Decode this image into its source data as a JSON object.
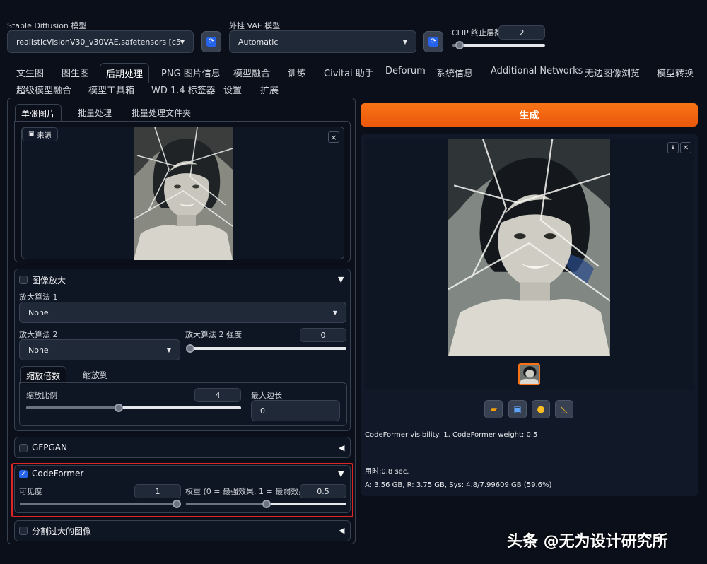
{
  "header": {
    "sd_model_label": "Stable Diffusion 模型",
    "sd_model_value": "realisticVisionV30_v30VAE.safetensors [c52892e",
    "vae_label": "外挂 VAE 模型",
    "vae_value": "Automatic",
    "clip_label": "CLIP 终止层数",
    "clip_value": "2",
    "clip_fraction": 0.08
  },
  "main_tabs": [
    "文生图",
    "图生图",
    "后期处理",
    "PNG 图片信息",
    "模型融合",
    "训练",
    "Civitai 助手",
    "Deforum",
    "系统信息",
    "Additional Networks",
    "无边图像浏览",
    "模型转换",
    "超级模型融合",
    "模型工具箱",
    "WD 1.4 标签器",
    "设置",
    "扩展"
  ],
  "sub_tabs": [
    "单张图片",
    "批量处理",
    "批量处理文件夹"
  ],
  "source": {
    "label": "来源",
    "close": "×"
  },
  "upscale": {
    "title": "图像放大",
    "algo1_label": "放大算法 1",
    "algo1_value": "None",
    "algo2_label": "放大算法 2",
    "algo2_value": "None",
    "algo2_strength_label": "放大算法 2 强度",
    "algo2_strength_value": "0",
    "algo2_strength_fraction": 0.0,
    "mode_tabs": [
      "缩放倍数",
      "缩放到"
    ],
    "scale_label": "缩放比例",
    "scale_value": "4",
    "scale_fraction": 0.43,
    "max_side_label": "最大边长",
    "max_side_value": "0"
  },
  "gfpgan": {
    "title": "GFPGAN"
  },
  "codeformer": {
    "title": "CodeFormer",
    "visibility_label": "可见度",
    "visibility_value": "1",
    "visibility_fraction": 1.0,
    "weight_label": "权重 (0 = 最强效果, 1 = 最弱效果)",
    "weight_value": "0.5",
    "weight_fraction": 0.5
  },
  "split": {
    "title": "分割过大的图像"
  },
  "generate_label": "生成",
  "output": {
    "info": "CodeFormer visibility: 1, CodeFormer weight: 0.5",
    "time": "用时:0.8 sec.",
    "mem": "A: 3.56 GB, R: 3.75 GB, Sys: 4.8/7.99609 GB (59.6%)"
  },
  "watermark": "头条 @无为设计研究所",
  "colors": {
    "accent": "#f97316",
    "highlight": "#dc2626",
    "checkbox": "#2563eb"
  }
}
